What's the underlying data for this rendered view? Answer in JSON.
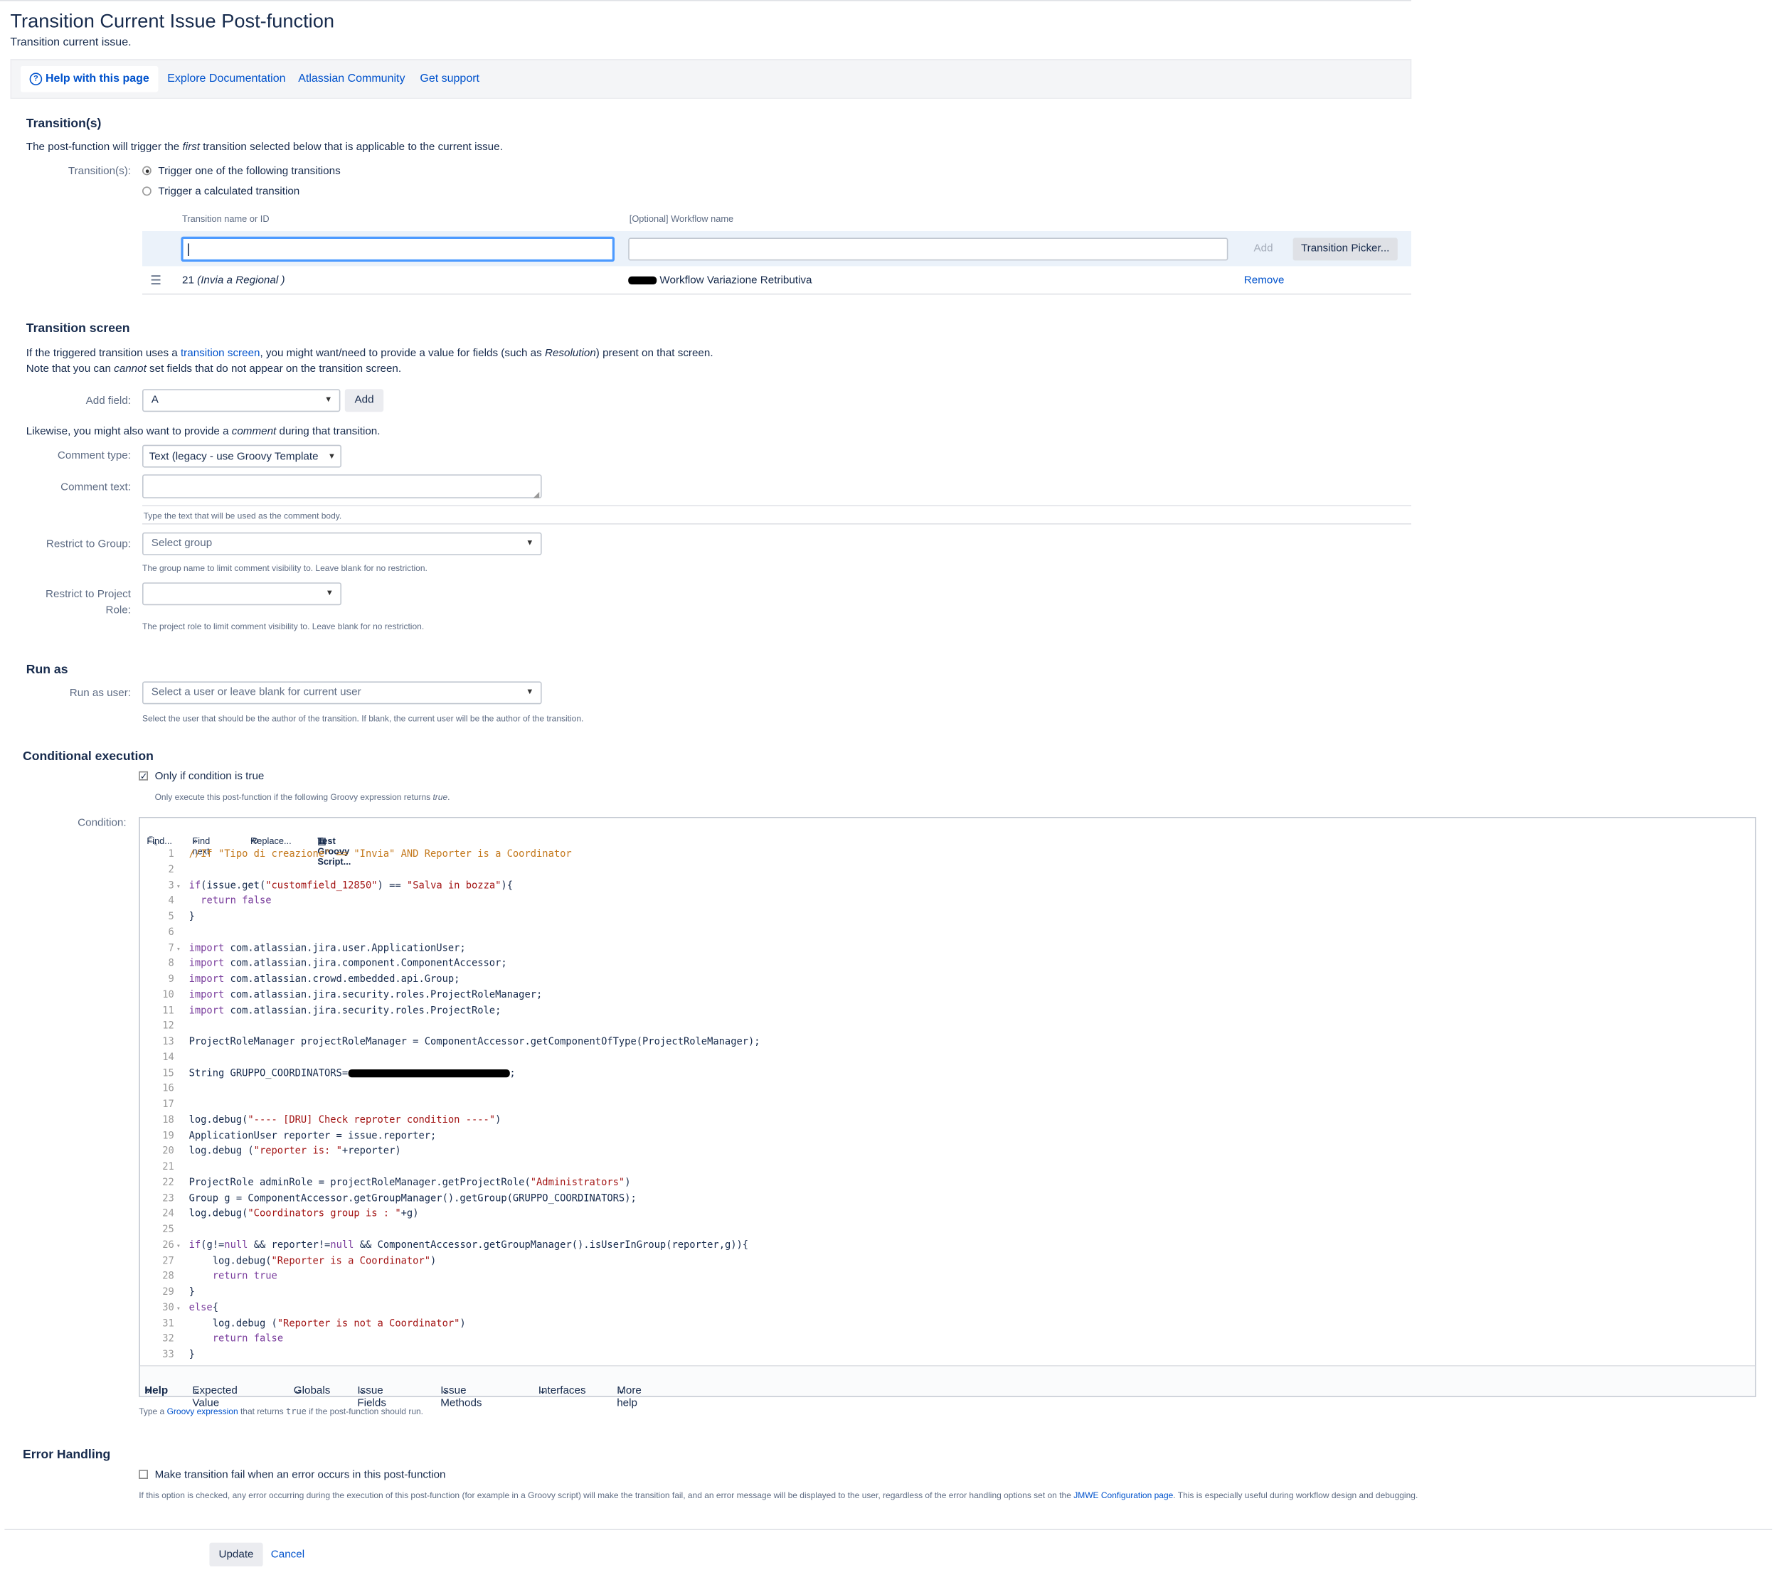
{
  "page": {
    "title": "Transition Current Issue Post-function",
    "subtitle": "Transition current issue."
  },
  "helpbar": {
    "items": [
      "Help with this page",
      "Explore Documentation",
      "Atlassian Community",
      "Get support"
    ]
  },
  "transitions": {
    "heading": "Transition(s)",
    "intro_pre": "The post-function will trigger the ",
    "intro_em": "first",
    "intro_post": " transition selected below that is applicable to the current issue.",
    "label": "Transition(s):",
    "option1": "Trigger one of the following transitions",
    "option2": "Trigger a calculated transition",
    "col1": "Transition name or ID",
    "col2": "[Optional] Workflow name",
    "add_label": "Add",
    "picker_label": "Transition Picker...",
    "row": {
      "id": "21",
      "name": "(Invia a Regional )",
      "workflow": "Workflow Variazione Retributiva",
      "remove": "Remove"
    }
  },
  "screen": {
    "heading": "Transition screen",
    "desc1_a": "If the triggered transition uses a ",
    "desc1_link": "transition screen",
    "desc1_b": ", you might want/need to provide a value for fields (such as ",
    "desc1_em": "Resolution",
    "desc1_c": ") present on that screen.",
    "desc2_a": "Note that you can ",
    "desc2_em": "cannot",
    "desc2_b": " set fields that do not appear on the transition screen.",
    "add_field_label": "Add field:",
    "add_field_value": "A",
    "add_button": "Add",
    "likewise_a": "Likewise, you might also want to provide a ",
    "likewise_em": "comment",
    "likewise_b": " during that transition.",
    "comment_type_label": "Comment type:",
    "comment_type_value": "Text (legacy - use Groovy Template",
    "comment_text_label": "Comment text:",
    "comment_text_help": "Type the text that will be used as the comment body.",
    "group_label": "Restrict to Group:",
    "group_placeholder": "Select group",
    "group_help": "The group name to limit comment visibility to. Leave blank for no restriction.",
    "role_label_1": "Restrict to Project",
    "role_label_2": "Role:",
    "role_help": "The project role to limit comment visibility to. Leave blank for no restriction."
  },
  "runas": {
    "heading": "Run as",
    "label": "Run as user:",
    "placeholder": "Select a user or leave blank for current user",
    "help": "Select the user that should be the author of the transition. If blank, the current user will be the author of the transition."
  },
  "conditional": {
    "heading": "Conditional execution",
    "checkbox": "Only if condition is true",
    "help_a": "Only execute this post-function if the following Groovy expression returns ",
    "help_em": "true",
    "help_b": ".",
    "condition_label": "Condition:",
    "toolbar": [
      "Find...",
      "Find next",
      "Replace...",
      "Test Groovy Script..."
    ],
    "bottom": [
      "Help",
      "Expected Value",
      "Globals",
      "Issue Fields",
      "Issue Methods",
      "Interfaces",
      "More help"
    ],
    "footer_a": "Type a ",
    "footer_link": "Groovy expression",
    "footer_b": " that returns ",
    "footer_code": "true",
    "footer_c": " if the post-function should run."
  },
  "code": [
    "//If \"Tipo di creazione\" == \"Invia\" AND Reporter is a Coordinator",
    "",
    "if(issue.get(\"customfield_12850\") == \"Salva in bozza\"){",
    "  return false",
    "}",
    "",
    "import com.atlassian.jira.user.ApplicationUser;",
    "import com.atlassian.jira.component.ComponentAccessor;",
    "import com.atlassian.crowd.embedded.api.Group;",
    "import com.atlassian.jira.security.roles.ProjectRoleManager;",
    "import com.atlassian.jira.security.roles.ProjectRole;",
    "",
    "ProjectRoleManager projectRoleManager = ComponentAccessor.getComponentOfType(ProjectRoleManager);",
    "",
    "String GRUPPO_COORDINATORS=",
    "",
    "",
    "log.debug(\"---- [DRU] Check reproter condition ----\")",
    "ApplicationUser reporter = issue.reporter;",
    "log.debug (\"reporter is: \"+reporter)",
    "",
    "ProjectRole adminRole = projectRoleManager.getProjectRole(\"Administrators\")",
    "Group g = ComponentAccessor.getGroupManager().getGroup(GRUPPO_COORDINATORS);",
    "log.debug(\"Coordinators group is : \"+g)",
    "",
    "if(g!=null && reporter!=null && ComponentAccessor.getGroupManager().isUserInGroup(reporter,g)){",
    "    log.debug(\"Reporter is a Coordinator\")",
    "    return true",
    "}",
    "else{",
    "    log.debug (\"Reporter is not a Coordinator\")",
    "    return false",
    "}"
  ],
  "error": {
    "heading": "Error Handling",
    "checkbox": "Make transition fail when an error occurs in this post-function",
    "help_a": "If this option is checked, any error occurring during the execution of this post-function (for example in a Groovy script) will make the transition fail, and an error message will be displayed to the user, regardless of the error handling options set on the ",
    "help_link": "JMWE Configuration page",
    "help_b": ". This is especially useful during workflow design and debugging."
  },
  "actions": {
    "update": "Update",
    "cancel": "Cancel"
  }
}
